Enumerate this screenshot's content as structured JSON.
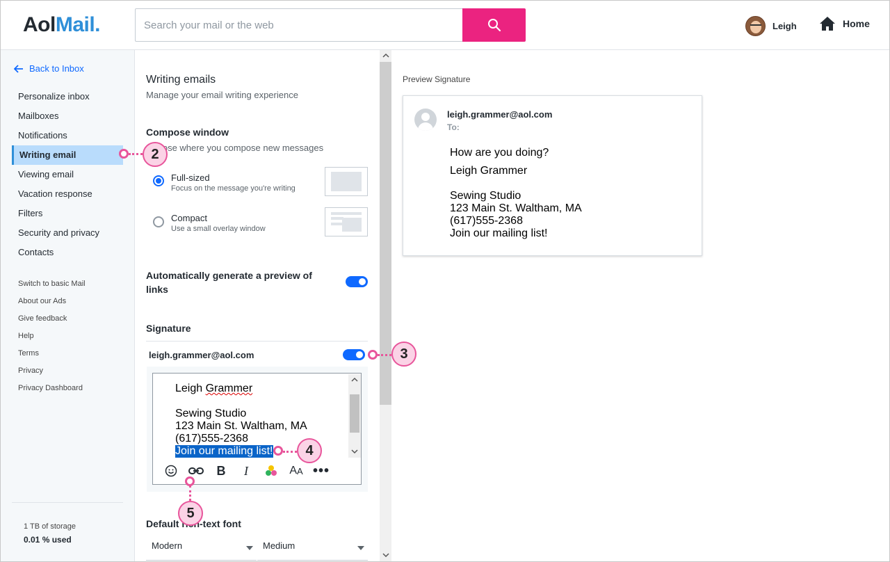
{
  "header": {
    "logo_aol": "Aol",
    "logo_mail": "Mail.",
    "search_placeholder": "Search your mail or the web",
    "user_name": "Leigh",
    "home_label": "Home"
  },
  "sidebar": {
    "back_label": "Back to Inbox",
    "items": [
      {
        "label": "Personalize inbox"
      },
      {
        "label": "Mailboxes"
      },
      {
        "label": "Notifications"
      },
      {
        "label": "Writing email"
      },
      {
        "label": "Viewing email"
      },
      {
        "label": "Vacation response"
      },
      {
        "label": "Filters"
      },
      {
        "label": "Security and privacy"
      },
      {
        "label": "Contacts"
      }
    ],
    "links": [
      {
        "label": "Switch to basic Mail"
      },
      {
        "label": "About our Ads"
      },
      {
        "label": "Give feedback"
      },
      {
        "label": "Help"
      },
      {
        "label": "Terms"
      },
      {
        "label": "Privacy"
      },
      {
        "label": "Privacy Dashboard"
      }
    ],
    "storage_total": "1 TB of storage",
    "storage_used": "0.01 % used"
  },
  "panel": {
    "title": "Writing emails",
    "subtitle": "Manage your email writing experience",
    "compose_title": "Compose window",
    "compose_sub": "Choose where you compose new messages",
    "options": [
      {
        "label": "Full-sized",
        "desc": "Focus on the message you're writing",
        "selected": true
      },
      {
        "label": "Compact",
        "desc": "Use a small overlay window",
        "selected": false
      }
    ],
    "auto_preview_label": "Automatically generate a preview of links",
    "auto_preview_on": true,
    "signature_title": "Signature",
    "signature_account": "leigh.grammer@aol.com",
    "signature_on": true,
    "editor_lines": {
      "name": "Leigh Grammer",
      "studio": "Sewing Studio",
      "address": "123 Main St. Waltham, MA",
      "phone": "(617)555-2368",
      "selected": "Join our mailing list!"
    },
    "font_title": "Default rich-text font",
    "font_family": "Modern",
    "font_size": "Medium"
  },
  "preview": {
    "label": "Preview Signature",
    "from": "leigh.grammer@aol.com",
    "to": "To:",
    "lines": [
      "How are you doing?",
      "Leigh Grammer",
      "Sewing Studio",
      "123 Main St. Waltham, MA",
      "(617)555-2368",
      "Join our mailing list!"
    ]
  },
  "callouts": [
    "2",
    "3",
    "4",
    "5"
  ],
  "colors": {
    "accent": "#0f69ff",
    "search_button": "#eb2380",
    "active_nav": "#b9dcfc",
    "callout": "#e8559b"
  }
}
